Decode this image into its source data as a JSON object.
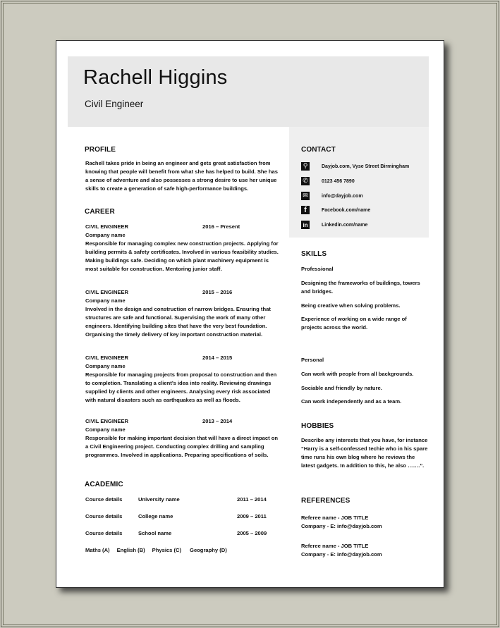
{
  "header": {
    "name": "Rachell Higgins",
    "role": "Civil Engineer"
  },
  "profile": {
    "heading": "PROFILE",
    "text": "Rachell takes pride in being an engineer and gets great satisfaction from knowing that people will benefit from what she has helped to build. She has a sense of adventure and also possesses a strong desire to use her unique skills to create a generation of safe high-performance buildings."
  },
  "career": {
    "heading": "CAREER",
    "jobs": [
      {
        "title": "CIVIL ENGINEER",
        "dates": "2016 – Present",
        "company": "Company name",
        "desc": "Responsible for managing complex new construction projects. Applying for building permits & safety certificates. Involved in various feasibility studies. Making buildings safe. Deciding on which plant machinery equipment is most suitable for construction. Mentoring junior staff."
      },
      {
        "title": "CIVIL ENGINEER",
        "dates": "2015 – 2016",
        "company": "Company name",
        "desc": "Involved in the design and construction of narrow bridges. Ensuring that structures are safe and functional. Supervising the work of many other engineers. Identifying building sites that have the very best foundation. Organising the timely delivery of key important construction material."
      },
      {
        "title": "CIVIL ENGINEER",
        "dates": "2014 – 2015",
        "company": "Company name",
        "desc": "Responsible for managing projects from proposal to construction and then to completion. Translating a client’s idea into reality. Reviewing drawings supplied by clients and other engineers. Analysing every risk associated with natural disasters such as earthquakes as well as floods."
      },
      {
        "title": "CIVIL ENGINEER",
        "dates": "2013 – 2014",
        "company": "Company name",
        "desc": "Responsible for making important decision that will have a direct impact on a Civil Engineering project. Conducting complex drilling and sampling programmes. Involved in applications. Preparing specifications of soils."
      }
    ]
  },
  "academic": {
    "heading": "ACADEMIC",
    "rows": [
      {
        "course": "Course details",
        "institution": "University name",
        "dates": "2011 – 2014"
      },
      {
        "course": "Course details",
        "institution": "College name",
        "dates": "2009 – 2011"
      },
      {
        "course": "Course details",
        "institution": "School name",
        "dates": "2005 – 2009"
      }
    ],
    "subjects": [
      "Maths (A)",
      "English (B)",
      "Physics (C)",
      "Geography (D)"
    ]
  },
  "contact": {
    "heading": "CONTACT",
    "items": [
      {
        "icon": "location-pin-icon",
        "glyph": "⚲",
        "text": "Dayjob.com, Vyse Street Birmingham"
      },
      {
        "icon": "phone-icon",
        "glyph": "✆",
        "text": "0123 456 7890"
      },
      {
        "icon": "email-icon",
        "glyph": "✉",
        "text": "info@dayjob.com"
      },
      {
        "icon": "facebook-icon",
        "glyph": "f",
        "text": "Facebook.com/name"
      },
      {
        "icon": "linkedin-icon",
        "glyph": "in",
        "text": "Linkedin.com/name"
      }
    ]
  },
  "skills": {
    "heading": "SKILLS",
    "professional_label": "Professional",
    "professional": [
      "Designing the frameworks of buildings, towers and bridges.",
      "Being creative when solving problems.",
      "Experience of working on a wide range of projects across the world."
    ],
    "personal_label": "Personal",
    "personal": [
      "Can work with people from all backgrounds.",
      "Sociable and friendly by nature.",
      "Can work independently and as a team."
    ]
  },
  "hobbies": {
    "heading": "HOBBIES",
    "text": "Describe any interests that you have, for instance “Harry is a self-confessed techie who in his spare time runs his own blog where he reviews the latest gadgets. In addition to this, he also …….”."
  },
  "references": {
    "heading": "REFERENCES",
    "items": [
      {
        "line1": "Referee name - JOB TITLE",
        "line2": "Company - E: info@dayjob.com"
      },
      {
        "line1": "Referee name - JOB TITLE",
        "line2": "Company - E: info@dayjob.com"
      }
    ]
  }
}
